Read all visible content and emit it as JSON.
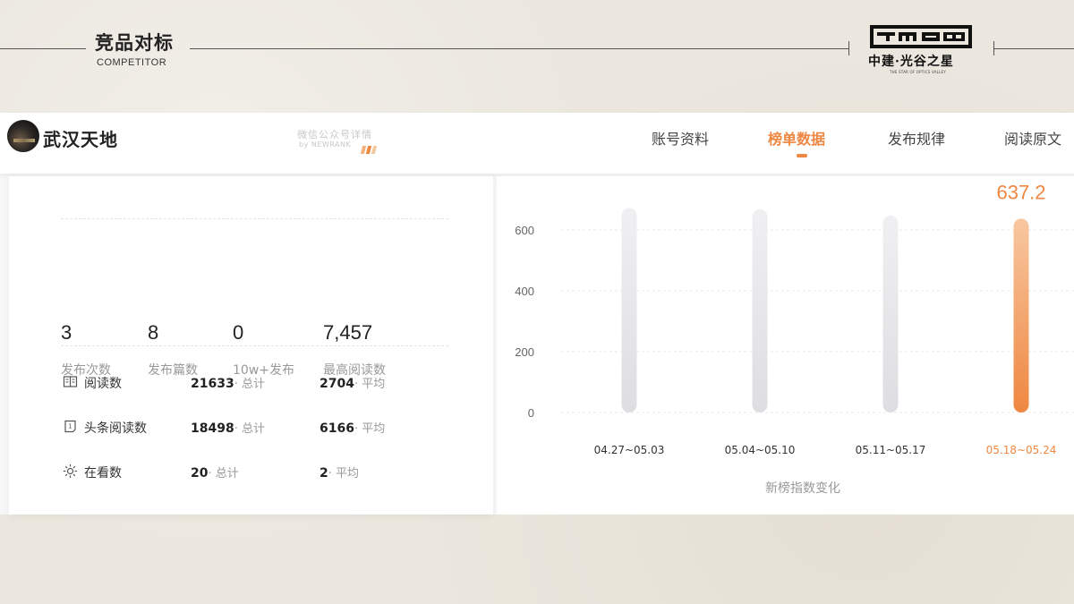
{
  "header": {
    "title_cn": "竞品对标",
    "title_en": "COMPETITOR",
    "logo_cn": "中建·光谷之星",
    "logo_en": "THE STAR OF OPTICS VALLEY"
  },
  "account": {
    "name": "武汉天地",
    "watermark_cn": "微信公众号详情",
    "watermark_en": "by NEWRANK"
  },
  "nav": {
    "tabs": [
      {
        "label": "账号资料",
        "active": false
      },
      {
        "label": "榜单数据",
        "active": true
      },
      {
        "label": "发布规律",
        "active": false
      },
      {
        "label": "阅读原文",
        "active": false
      }
    ]
  },
  "stats": [
    {
      "value": "3",
      "label": "发布次数"
    },
    {
      "value": "8",
      "label": "发布篇数"
    },
    {
      "value": "0",
      "label": "10w+发布"
    },
    {
      "value": "7,457",
      "label": "最高阅读数"
    }
  ],
  "metrics": [
    {
      "icon": "book-icon",
      "name": "阅读数",
      "total": "21633",
      "total_suffix": "· 总计",
      "avg": "2704",
      "avg_suffix": "· 平均"
    },
    {
      "icon": "headline-icon",
      "name": "头条阅读数",
      "total": "18498",
      "total_suffix": "· 总计",
      "avg": "6166",
      "avg_suffix": "· 平均"
    },
    {
      "icon": "sun-icon",
      "name": "在看数",
      "total": "20",
      "total_suffix": "· 总计",
      "avg": "2",
      "avg_suffix": "· 平均"
    }
  ],
  "colors": {
    "accent": "#ee8741",
    "bar_gray": "#e4e4e8"
  },
  "chart_data": {
    "type": "bar",
    "categories": [
      "04.27~05.03",
      "05.04~05.10",
      "05.11~05.17",
      "05.18~05.24"
    ],
    "values": [
      672,
      668,
      648,
      637.2
    ],
    "highlight_index": 3,
    "highlight_label": "637.2",
    "ylim": [
      0,
      700
    ],
    "yticks": [
      0,
      200,
      400,
      600
    ],
    "grid": true,
    "xlabel": "新榜指数变化"
  }
}
